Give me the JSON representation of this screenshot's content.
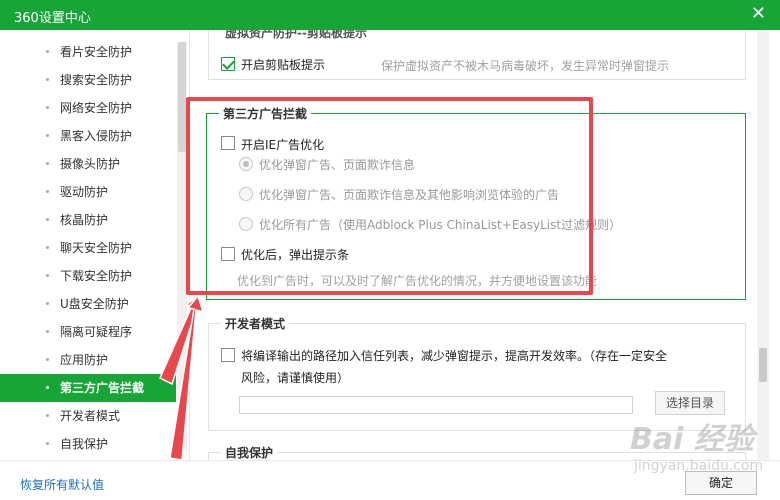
{
  "window": {
    "title": "360设置中心",
    "close_glyph": "✕"
  },
  "sidebar": {
    "items": [
      {
        "label": "看片安全防护"
      },
      {
        "label": "搜索安全防护"
      },
      {
        "label": "网络安全防护"
      },
      {
        "label": "黑客入侵防护"
      },
      {
        "label": "摄像头防护"
      },
      {
        "label": "驱动防护"
      },
      {
        "label": "核晶防护"
      },
      {
        "label": "聊天安全防护"
      },
      {
        "label": "下载安全防护"
      },
      {
        "label": "U盘安全防护"
      },
      {
        "label": "隔离可疑程序"
      },
      {
        "label": "应用防护"
      },
      {
        "label": "第三方广告拦截"
      },
      {
        "label": "开发者模式"
      },
      {
        "label": "自我保护"
      }
    ],
    "active_index": 12
  },
  "clipboard_section": {
    "title_fragment": "虚拟资产防护--剪贴板提示",
    "option_label": "开启剪贴板提示",
    "option_checked": true,
    "hint": "保护虚拟资产不被木马病毒破坏，发生异常时弹窗提示"
  },
  "ad_section": {
    "title": "第三方广告拦截",
    "ie_option": {
      "label": "开启IE广告优化",
      "checked": false
    },
    "radio_options": [
      {
        "label": "优化弹窗广告、页面欺诈信息",
        "selected": true
      },
      {
        "label": "优化弹窗广告、页面欺诈信息及其他影响浏览体验的广告",
        "selected": false
      },
      {
        "label": "优化所有广告（使用Adblock Plus ChinaList+EasyList过滤规则）",
        "selected": false
      }
    ],
    "popup_option": {
      "label": "优化后，弹出提示条",
      "checked": false
    },
    "hint": "优化到广告时，可以及时了解广告优化的情况，并方便地设置该功能"
  },
  "dev_section": {
    "title": "开发者模式",
    "option_label_line1": "将编译输出的路径加入信任列表，减少弹窗提示，提高开发效率。（存在一定安全",
    "option_label_line2": "风险，请谨慎使用）",
    "option_checked": false,
    "path_value": "",
    "select_dir_button": "选择目录"
  },
  "self_protect_section": {
    "title": "自我保护"
  },
  "footer": {
    "restore_defaults": "恢复所有默认值",
    "ok_button": "确定"
  },
  "watermark": {
    "main": "Bai 经验",
    "sub": "jingyan.baidu.com"
  },
  "colors": {
    "brand_green": "#17a538",
    "annotation_red": "#e8474c",
    "link_blue": "#1a6fc4"
  }
}
